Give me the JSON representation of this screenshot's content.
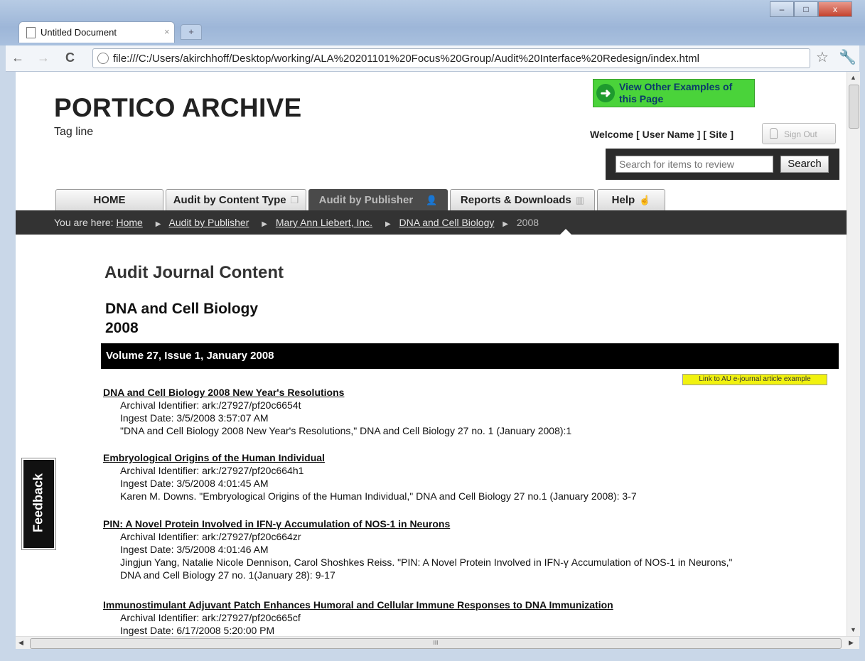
{
  "browser": {
    "tab_title": "Untitled Document",
    "tab_close": "×",
    "new_tab": "+",
    "url": "file:///C:/Users/akirchhoff/Desktop/working/ALA%20201101%20Focus%20Group/Audit%20Interface%20Redesign/index.html",
    "back": "←",
    "forward": "→",
    "reload": "C",
    "star": "☆",
    "wrench": "🔧",
    "window_min": "–",
    "window_max": "□",
    "window_close": "x",
    "hscroll_grip": "III"
  },
  "header": {
    "logo": "PORTICO ARCHIVE",
    "tagline": "Tag line",
    "example_button": "View Other Examples of this Page",
    "welcome": "Welcome [ User Name ] [ Site ]",
    "sign_out": "Sign Out",
    "search_placeholder": "Search for items to review",
    "search_button": "Search"
  },
  "nav": {
    "tabs": [
      {
        "label": "HOME"
      },
      {
        "label": "Audit by Content Type"
      },
      {
        "label": "Audit by Publisher"
      },
      {
        "label": "Reports & Downloads"
      },
      {
        "label": "Help"
      }
    ]
  },
  "breadcrumb": {
    "prefix": "You are here:",
    "items": [
      "Home",
      "Audit by Publisher",
      "Mary Ann Liebert, Inc.",
      "DNA and Cell Biology"
    ],
    "current": "2008"
  },
  "main": {
    "heading": "Audit Journal Content",
    "journal": "DNA and Cell Biology",
    "year": "2008",
    "volume_bar": "Volume 27, Issue 1, January 2008",
    "au_link": "Link to AU e-journal article example",
    "articles": [
      {
        "title": "DNA and Cell Biology 2008 New Year's Resolutions",
        "identifier": "Archival Identifier: ark:/27927/pf20c6654t",
        "ingest": "Ingest Date: 3/5/2008 3:57:07 AM",
        "citation": "\"DNA and Cell Biology 2008 New Year's Resolutions,\" DNA and Cell Biology 27 no. 1 (January 2008):1"
      },
      {
        "title": "Embryological Origins of the Human Individual",
        "identifier": "Archival Identifier: ark:/27927/pf20c664h1",
        "ingest": "Ingest Date: 3/5/2008 4:01:45 AM",
        "citation": "Karen M. Downs.  \"Embryological Origins of the Human Individual,\" DNA and Cell Biology 27 no.1 (January 2008): 3-7"
      },
      {
        "title": "PIN: A Novel Protein Involved in IFN-γ Accumulation of NOS-1 in Neurons",
        "identifier": "Archival Identifier: ark:/27927/pf20c664zr",
        "ingest": "Ingest Date: 3/5/2008 4:01:46 AM",
        "citation": "Jingjun Yang, Natalie Nicole Dennison, Carol Shoshkes Reiss.  \"PIN: A Novel Protein Involved in IFN-γ Accumulation of NOS-1 in Neurons,\"",
        "citation2": "DNA and Cell Biology 27 no. 1(January 28): 9-17"
      },
      {
        "title": "Immunostimulant Adjuvant Patch Enhances Humoral and Cellular Immune Responses to DNA Immunization",
        "identifier": "Archival Identifier: ark:/27927/pf20c665cf",
        "ingest": "Ingest Date: 6/17/2008 5:20:00 PM"
      }
    ]
  },
  "feedback": "Feedback"
}
